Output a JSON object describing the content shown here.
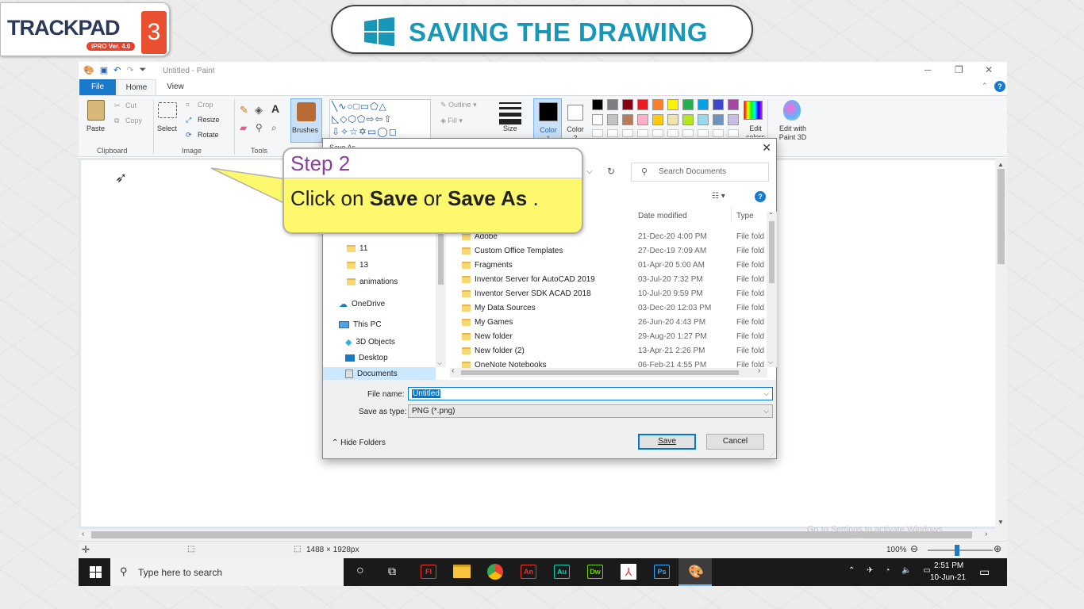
{
  "logo": {
    "name": "TRACKPAD",
    "version": "iPRO Ver. 4.0",
    "number": "3"
  },
  "banner": {
    "title": "SAVING THE DRAWING"
  },
  "paint": {
    "window_title": "Untitled - Paint",
    "tabs": {
      "file": "File",
      "home": "Home",
      "view": "View"
    },
    "clipboard": {
      "paste": "Paste",
      "cut": "Cut",
      "copy": "Copy",
      "group": "Clipboard"
    },
    "image": {
      "select": "Select",
      "crop": "Crop",
      "resize": "Resize",
      "rotate": "Rotate",
      "group": "Image"
    },
    "tools": {
      "group": "Tools"
    },
    "brushes": "Brushes",
    "shapes": {
      "outline": "Outline",
      "fill": "Fill"
    },
    "size": "Size",
    "color1": "Color 1",
    "color2": "Color 2",
    "edit_colors": "Edit colors",
    "edit_paint3d": "Edit with Paint 3D",
    "palette": [
      "#000000",
      "#7f7f7f",
      "#880015",
      "#ed1c24",
      "#ff7f27",
      "#fff200",
      "#22b14c",
      "#00a2e8",
      "#3f48cc",
      "#a349a4",
      "#ffffff",
      "#c3c3c3",
      "#b97a57",
      "#ffaec9",
      "#ffc90e",
      "#efe4b0",
      "#b5e61d",
      "#99d9ea",
      "#7092be",
      "#c8bfe7"
    ],
    "status": {
      "dimensions": "1488 × 1928px",
      "zoom": "100%"
    },
    "watermark": "Go to Settings to activate Windows."
  },
  "dialog": {
    "title": "Save As",
    "search_placeholder": "Search Documents",
    "nav": [
      {
        "label": "11",
        "icon": "folder-icon"
      },
      {
        "label": "13",
        "icon": "folder-icon"
      },
      {
        "label": "animations",
        "icon": "folder-icon"
      },
      {
        "label": "OneDrive",
        "icon": "cloud-icon"
      },
      {
        "label": "This PC",
        "icon": "computer-icon"
      },
      {
        "label": "3D Objects",
        "icon": "cube-icon"
      },
      {
        "label": "Desktop",
        "icon": "desktop-icon"
      },
      {
        "label": "Documents",
        "icon": "documents-icon"
      }
    ],
    "columns": {
      "date": "Date modified",
      "type": "Type"
    },
    "files": [
      {
        "name": "Adobe",
        "date": "21-Dec-20 4:00 PM",
        "type": "File fold"
      },
      {
        "name": "Custom Office Templates",
        "date": "27-Dec-19 7:09 AM",
        "type": "File fold"
      },
      {
        "name": "Fragments",
        "date": "01-Apr-20 5:00 AM",
        "type": "File fold"
      },
      {
        "name": "Inventor Server for AutoCAD 2019",
        "date": "03-Jul-20 7:32 PM",
        "type": "File fold"
      },
      {
        "name": "Inventor Server SDK ACAD 2018",
        "date": "10-Jul-20 9:59 PM",
        "type": "File fold"
      },
      {
        "name": "My Data Sources",
        "date": "03-Dec-20 12:03 PM",
        "type": "File fold"
      },
      {
        "name": "My Games",
        "date": "26-Jun-20 4:43 PM",
        "type": "File fold"
      },
      {
        "name": "New folder",
        "date": "29-Aug-20 1:27 PM",
        "type": "File fold"
      },
      {
        "name": "New folder (2)",
        "date": "13-Apr-21 2:26 PM",
        "type": "File fold"
      },
      {
        "name": "OneNote Notebooks",
        "date": "06-Feb-21 4:55 PM",
        "type": "File fold"
      }
    ],
    "file_name_label": "File name:",
    "file_name_value": "Untitled",
    "save_type_label": "Save as type:",
    "save_type_value": "PNG (*.png)",
    "hide_folders": "Hide Folders",
    "save_button": "Save",
    "cancel_button": "Cancel"
  },
  "callout": {
    "step": "Step 2",
    "text_prefix": "Click on ",
    "save": "Save",
    "or": " or ",
    "save_as": "Save As",
    "text_suffix": " ."
  },
  "taskbar": {
    "search_placeholder": "Type here to search",
    "apps": [
      {
        "label": "Fl",
        "color": "#e8352d"
      },
      {
        "label": "An",
        "color": "#e8352d"
      },
      {
        "label": "Au",
        "color": "#00d4b0"
      },
      {
        "label": "Dw",
        "color": "#6cd400"
      },
      {
        "label": "Ps",
        "color": "#31a8ff"
      }
    ],
    "time": "2:51 PM",
    "date": "10-Jun-21"
  }
}
